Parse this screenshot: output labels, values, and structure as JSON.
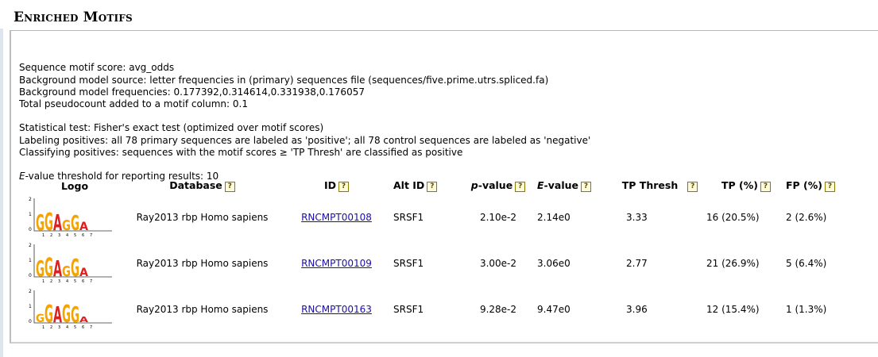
{
  "title": "Enriched Motifs",
  "info": {
    "line1": "Sequence motif score: avg_odds",
    "line2": "Background model source: letter frequencies in (primary) sequences file (sequences/five.prime.utrs.spliced.fa)",
    "line3": "Background model frequencies: 0.177392,0.314614,0.331938,0.176057",
    "line4": "Total pseudocount added to a motif column: 0.1",
    "line5": "Statistical test: Fisher's exact test (optimized over motif scores)",
    "line6": "Labeling positives: all 78 primary sequences are labeled as 'positive'; all 78 control sequences are labeled as 'negative'",
    "line7": "Classifying positives: sequences with the motif scores ≥ 'TP Thresh' are classified as positive",
    "evalue_label": "E",
    "evalue_rest": "-value threshold for reporting results: 10"
  },
  "table": {
    "headers": {
      "logo": "Logo",
      "database": "Database",
      "id": "ID",
      "alt_id": "Alt ID",
      "pvalue_p": "p",
      "pvalue_rest": "-value",
      "evalue_e": "E",
      "evalue_rest": "-value",
      "tp_thresh": "TP Thresh",
      "tp": "TP (%)",
      "fp": "FP (%)",
      "help": "?"
    },
    "rows": [
      {
        "logo_letters": "GGAGGA",
        "database": "Ray2013 rbp Homo sapiens",
        "id": "RNCMPT00108",
        "alt_id": "SRSF1",
        "pvalue": "2.10e-2",
        "evalue": "2.14e0",
        "tp_thresh": "3.33",
        "tp": "16 (20.5%)",
        "fp": "2 (2.6%)"
      },
      {
        "logo_letters": "GGAGGA",
        "database": "Ray2013 rbp Homo sapiens",
        "id": "RNCMPT00109",
        "alt_id": "SRSF1",
        "pvalue": "3.00e-2",
        "evalue": "3.06e0",
        "tp_thresh": "2.77",
        "tp": "21 (26.9%)",
        "fp": "5 (6.4%)"
      },
      {
        "logo_letters": "GGAGGA",
        "database": "Ray2013 rbp Homo sapiens",
        "id": "RNCMPT00163",
        "alt_id": "SRSF1",
        "pvalue": "9.28e-2",
        "evalue": "9.47e0",
        "tp_thresh": "3.96",
        "tp": "12 (15.4%)",
        "fp": "1 (1.3%)"
      }
    ]
  },
  "colors": {
    "G": "#f5a300",
    "A": "#e02020",
    "C": "#2030c0",
    "U": "#20a020",
    "link": "#1a0dab"
  }
}
